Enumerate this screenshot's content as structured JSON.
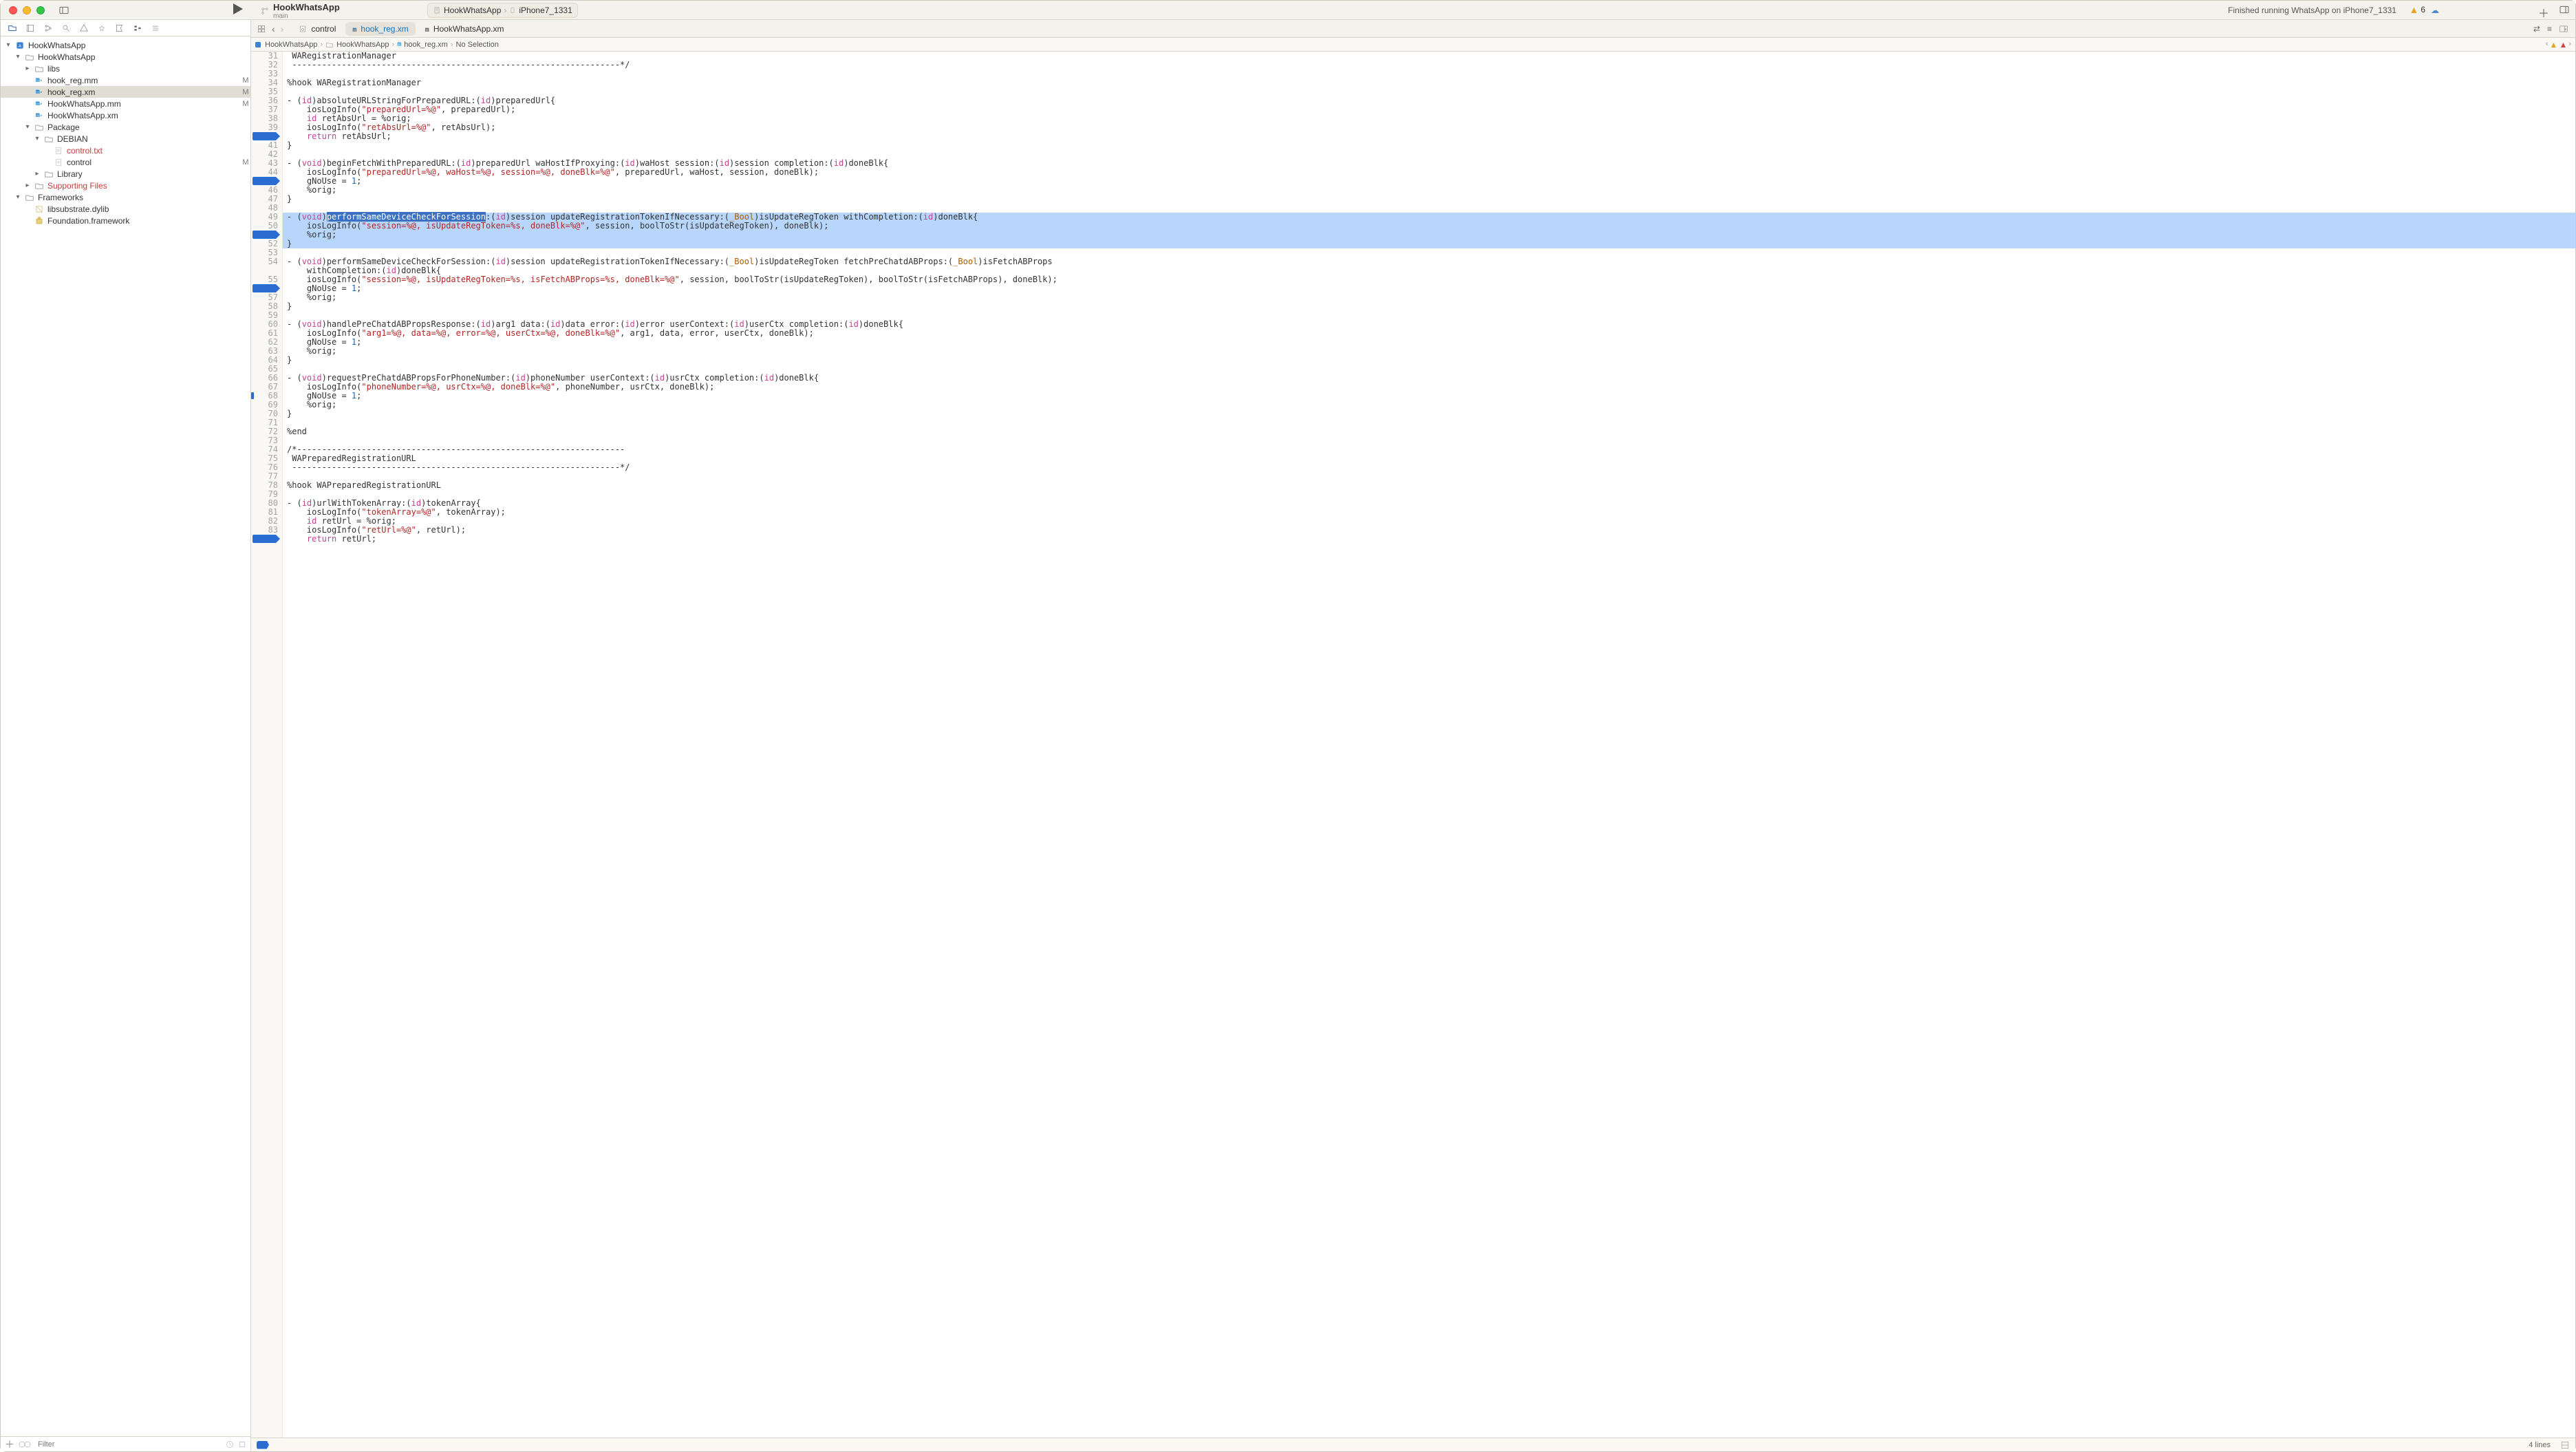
{
  "window": {
    "project_name": "HookWhatsApp",
    "branch": "main",
    "scheme": "HookWhatsApp",
    "destination": "iPhone7_1331",
    "status_message": "Finished running WhatsApp on iPhone7_1331",
    "warning_count": "6"
  },
  "tabs": [
    {
      "name": "control",
      "icon": "doc-settings-icon",
      "active": false
    },
    {
      "name": "hook_reg.xm",
      "icon": "m-file-icon",
      "active": true,
      "color": "#1175c1"
    },
    {
      "name": "HookWhatsApp.xm",
      "icon": "m-file-icon",
      "active": false
    }
  ],
  "breadcrumb": {
    "items": [
      "HookWhatsApp",
      "HookWhatsApp",
      "hook_reg.xm",
      "No Selection"
    ]
  },
  "sidebar": {
    "filter_placeholder": "Filter",
    "tree": [
      {
        "depth": 0,
        "expanded": true,
        "icon": "app-icon",
        "label": "HookWhatsApp"
      },
      {
        "depth": 1,
        "expanded": true,
        "icon": "folder-icon",
        "label": "HookWhatsApp"
      },
      {
        "depth": 2,
        "expanded": false,
        "icon": "folder-icon",
        "label": "libs",
        "has_children": true
      },
      {
        "depth": 2,
        "icon": "m-file-icon",
        "label": "hook_reg.mm",
        "status": "M"
      },
      {
        "depth": 2,
        "icon": "m-file-icon",
        "label": "hook_reg.xm",
        "status": "M",
        "selected": true
      },
      {
        "depth": 2,
        "icon": "m-file-icon",
        "label": "HookWhatsApp.mm",
        "status": "M"
      },
      {
        "depth": 2,
        "icon": "m-file-icon",
        "label": "HookWhatsApp.xm"
      },
      {
        "depth": 2,
        "expanded": true,
        "icon": "folder-icon",
        "label": "Package"
      },
      {
        "depth": 3,
        "expanded": true,
        "icon": "folder-icon",
        "label": "DEBIAN"
      },
      {
        "depth": 4,
        "icon": "text-file-icon",
        "label": "control.txt",
        "red": true
      },
      {
        "depth": 4,
        "icon": "text-file-icon",
        "label": "control",
        "status": "M"
      },
      {
        "depth": 3,
        "expanded": false,
        "icon": "folder-icon",
        "label": "Library",
        "has_children": true
      },
      {
        "depth": 2,
        "expanded": false,
        "icon": "folder-icon",
        "label": "Supporting Files",
        "red": true,
        "has_children": true
      },
      {
        "depth": 1,
        "expanded": true,
        "icon": "folder-icon",
        "label": "Frameworks"
      },
      {
        "depth": 2,
        "icon": "library-icon",
        "label": "libsubstrate.dylib"
      },
      {
        "depth": 2,
        "icon": "framework-icon",
        "label": "Foundation.framework"
      }
    ]
  },
  "editor": {
    "first_line_number": 31,
    "highlighted_range": [
      49,
      52
    ],
    "breakpoint_lines": [
      40,
      45,
      51,
      56,
      84
    ],
    "marker_lines": [
      45,
      51,
      56,
      68
    ],
    "lines": [
      {
        "n": 31,
        "t": [
          [
            " WARegistrationManager",
            ""
          ]
        ]
      },
      {
        "n": 32,
        "t": [
          [
            " ------------------------------------------------------------------*/",
            ""
          ]
        ]
      },
      {
        "n": 33,
        "t": [
          [
            "",
            ""
          ]
        ]
      },
      {
        "n": 34,
        "t": [
          [
            "%hook WARegistrationManager",
            ""
          ]
        ]
      },
      {
        "n": 35,
        "t": [
          [
            "",
            ""
          ]
        ]
      },
      {
        "n": 36,
        "t": [
          [
            "- (",
            ""
          ],
          [
            "id",
            "k"
          ],
          [
            ")absoluteURLStringForPreparedURL:(",
            ""
          ],
          [
            "id",
            "k"
          ],
          [
            ")preparedUrl{",
            ""
          ]
        ]
      },
      {
        "n": 37,
        "t": [
          [
            "    iosLogInfo(",
            ""
          ],
          [
            "\"preparedUrl=%@\"",
            "s"
          ],
          [
            ", preparedUrl);",
            ""
          ]
        ]
      },
      {
        "n": 38,
        "t": [
          [
            "    ",
            ""
          ],
          [
            "id",
            "k"
          ],
          [
            " retAbsUrl = %orig;",
            ""
          ]
        ]
      },
      {
        "n": 39,
        "t": [
          [
            "    iosLogInfo(",
            ""
          ],
          [
            "\"retAbsUrl=%@\"",
            "s"
          ],
          [
            ", retAbsUrl);",
            ""
          ]
        ]
      },
      {
        "n": 40,
        "t": [
          [
            "    ",
            ""
          ],
          [
            "return",
            "k"
          ],
          [
            " retAbsUrl;",
            ""
          ]
        ]
      },
      {
        "n": 41,
        "t": [
          [
            "}",
            ""
          ]
        ]
      },
      {
        "n": 42,
        "t": [
          [
            "",
            ""
          ]
        ]
      },
      {
        "n": 43,
        "t": [
          [
            "- (",
            ""
          ],
          [
            "void",
            "k"
          ],
          [
            ")beginFetchWithPreparedURL:(",
            ""
          ],
          [
            "id",
            "k"
          ],
          [
            ")preparedUrl waHostIfProxying:(",
            ""
          ],
          [
            "id",
            "k"
          ],
          [
            ")waHost session:(",
            ""
          ],
          [
            "id",
            "k"
          ],
          [
            ")session completion:(",
            ""
          ],
          [
            "id",
            "k"
          ],
          [
            ")doneBlk{",
            ""
          ]
        ]
      },
      {
        "n": 44,
        "t": [
          [
            "    iosLogInfo(",
            ""
          ],
          [
            "\"preparedUrl=%@, waHost=%@, session=%@, doneBlk=%@\"",
            "s"
          ],
          [
            ", preparedUrl, waHost, session, doneBlk);",
            ""
          ]
        ]
      },
      {
        "n": 45,
        "t": [
          [
            "    gNoUse = ",
            ""
          ],
          [
            "1",
            "n"
          ],
          [
            ";",
            ""
          ]
        ]
      },
      {
        "n": 46,
        "t": [
          [
            "    %orig;",
            ""
          ]
        ]
      },
      {
        "n": 47,
        "t": [
          [
            "}",
            ""
          ]
        ]
      },
      {
        "n": 48,
        "t": [
          [
            "",
            ""
          ]
        ]
      },
      {
        "n": 49,
        "t": [
          [
            "- (",
            ""
          ],
          [
            "void",
            "k"
          ],
          [
            ")",
            ""
          ],
          [
            "performSameDeviceCheckForSession",
            "hlspan"
          ],
          [
            ":(",
            ""
          ],
          [
            "id",
            "k"
          ],
          [
            ")session updateRegistrationTokenIfNecessary:(",
            ""
          ],
          [
            "_Bool",
            "b"
          ],
          [
            ")isUpdateRegToken withCompletion:(",
            ""
          ],
          [
            "id",
            "k"
          ],
          [
            ")doneBlk{",
            ""
          ]
        ]
      },
      {
        "n": 50,
        "t": [
          [
            "    iosLogInfo(",
            ""
          ],
          [
            "\"session=%@, isUpdateRegToken=%s, doneBlk=%@\"",
            "s"
          ],
          [
            ", session, boolToStr(isUpdateRegToken), doneBlk);",
            ""
          ]
        ]
      },
      {
        "n": 51,
        "t": [
          [
            "    %orig;",
            ""
          ]
        ]
      },
      {
        "n": 52,
        "t": [
          [
            "}",
            ""
          ]
        ]
      },
      {
        "n": 53,
        "t": [
          [
            "",
            ""
          ]
        ]
      },
      {
        "n": 54,
        "t": [
          [
            "- (",
            ""
          ],
          [
            "void",
            "k"
          ],
          [
            ")performSameDeviceCheckForSession:(",
            ""
          ],
          [
            "id",
            "k"
          ],
          [
            ")session updateRegistrationTokenIfNecessary:(",
            ""
          ],
          [
            "_Bool",
            "b"
          ],
          [
            ")isUpdateRegToken fetchPreChatdABProps:(",
            ""
          ],
          [
            "_Bool",
            "b"
          ],
          [
            ")isFetchABProps",
            ""
          ]
        ]
      },
      {
        "n": "",
        "t": [
          [
            "    withCompletion:(",
            ""
          ],
          [
            "id",
            "k"
          ],
          [
            ")doneBlk{",
            ""
          ]
        ],
        "cont": 54
      },
      {
        "n": 55,
        "t": [
          [
            "    iosLogInfo(",
            ""
          ],
          [
            "\"session=%@, isUpdateRegToken=%s, isFetchABProps=%s, doneBlk=%@\"",
            "s"
          ],
          [
            ", session, boolToStr(isUpdateRegToken), boolToStr(isFetchABProps), doneBlk);",
            ""
          ]
        ]
      },
      {
        "n": 56,
        "t": [
          [
            "    gNoUse = ",
            ""
          ],
          [
            "1",
            "n"
          ],
          [
            ";",
            ""
          ]
        ]
      },
      {
        "n": 57,
        "t": [
          [
            "    %orig;",
            ""
          ]
        ]
      },
      {
        "n": 58,
        "t": [
          [
            "}",
            ""
          ]
        ]
      },
      {
        "n": 59,
        "t": [
          [
            "",
            ""
          ]
        ]
      },
      {
        "n": 60,
        "t": [
          [
            "- (",
            ""
          ],
          [
            "void",
            "k"
          ],
          [
            ")handlePreChatdABPropsResponse:(",
            ""
          ],
          [
            "id",
            "k"
          ],
          [
            ")arg1 data:(",
            ""
          ],
          [
            "id",
            "k"
          ],
          [
            ")data error:(",
            ""
          ],
          [
            "id",
            "k"
          ],
          [
            ")error userContext:(",
            ""
          ],
          [
            "id",
            "k"
          ],
          [
            ")userCtx completion:(",
            ""
          ],
          [
            "id",
            "k"
          ],
          [
            ")doneBlk{",
            ""
          ]
        ]
      },
      {
        "n": 61,
        "t": [
          [
            "    iosLogInfo(",
            ""
          ],
          [
            "\"arg1=%@, data=%@, error=%@, userCtx=%@, doneBlk=%@\"",
            "s"
          ],
          [
            ", arg1, data, error, userCtx, doneBlk);",
            ""
          ]
        ]
      },
      {
        "n": 62,
        "t": [
          [
            "    gNoUse = ",
            ""
          ],
          [
            "1",
            "n"
          ],
          [
            ";",
            ""
          ]
        ]
      },
      {
        "n": 63,
        "t": [
          [
            "    %orig;",
            ""
          ]
        ]
      },
      {
        "n": 64,
        "t": [
          [
            "}",
            ""
          ]
        ]
      },
      {
        "n": 65,
        "t": [
          [
            "",
            ""
          ]
        ]
      },
      {
        "n": 66,
        "t": [
          [
            "- (",
            ""
          ],
          [
            "void",
            "k"
          ],
          [
            ")requestPreChatdABPropsForPhoneNumber:(",
            ""
          ],
          [
            "id",
            "k"
          ],
          [
            ")phoneNumber userContext:(",
            ""
          ],
          [
            "id",
            "k"
          ],
          [
            ")usrCtx completion:(",
            ""
          ],
          [
            "id",
            "k"
          ],
          [
            ")doneBlk{",
            ""
          ]
        ]
      },
      {
        "n": 67,
        "t": [
          [
            "    iosLogInfo(",
            ""
          ],
          [
            "\"phoneNumber=%@, usrCtx=%@, doneBlk=%@\"",
            "s"
          ],
          [
            ", phoneNumber, usrCtx, doneBlk);",
            ""
          ]
        ]
      },
      {
        "n": 68,
        "t": [
          [
            "    gNoUse = ",
            ""
          ],
          [
            "1",
            "n"
          ],
          [
            ";",
            ""
          ]
        ]
      },
      {
        "n": 69,
        "t": [
          [
            "    %orig;",
            ""
          ]
        ]
      },
      {
        "n": 70,
        "t": [
          [
            "}",
            ""
          ]
        ]
      },
      {
        "n": 71,
        "t": [
          [
            "",
            ""
          ]
        ]
      },
      {
        "n": 72,
        "t": [
          [
            "%end",
            ""
          ]
        ]
      },
      {
        "n": 73,
        "t": [
          [
            "",
            ""
          ]
        ]
      },
      {
        "n": 74,
        "t": [
          [
            "/*------------------------------------------------------------------",
            ""
          ]
        ]
      },
      {
        "n": 75,
        "t": [
          [
            " WAPreparedRegistrationURL",
            ""
          ]
        ]
      },
      {
        "n": 76,
        "t": [
          [
            " ------------------------------------------------------------------*/",
            ""
          ]
        ]
      },
      {
        "n": 77,
        "t": [
          [
            "",
            ""
          ]
        ]
      },
      {
        "n": 78,
        "t": [
          [
            "%hook WAPreparedRegistrationURL",
            ""
          ]
        ]
      },
      {
        "n": 79,
        "t": [
          [
            "",
            ""
          ]
        ]
      },
      {
        "n": 80,
        "t": [
          [
            "- (",
            ""
          ],
          [
            "id",
            "k"
          ],
          [
            ")urlWithTokenArray:(",
            ""
          ],
          [
            "id",
            "k"
          ],
          [
            ")tokenArray{",
            ""
          ]
        ]
      },
      {
        "n": 81,
        "t": [
          [
            "    iosLogInfo(",
            ""
          ],
          [
            "\"tokenArray=%@\"",
            "s"
          ],
          [
            ", tokenArray);",
            ""
          ]
        ]
      },
      {
        "n": 82,
        "t": [
          [
            "    ",
            ""
          ],
          [
            "id",
            "k"
          ],
          [
            " retUrl = %orig;",
            ""
          ]
        ]
      },
      {
        "n": 83,
        "t": [
          [
            "    iosLogInfo(",
            ""
          ],
          [
            "\"retUrl=%@\"",
            "s"
          ],
          [
            ", retUrl);",
            ""
          ]
        ]
      },
      {
        "n": 84,
        "t": [
          [
            "    ",
            ""
          ],
          [
            "return",
            "k"
          ],
          [
            " retUrl;",
            ""
          ]
        ]
      }
    ],
    "selection_info": "4 lines"
  }
}
